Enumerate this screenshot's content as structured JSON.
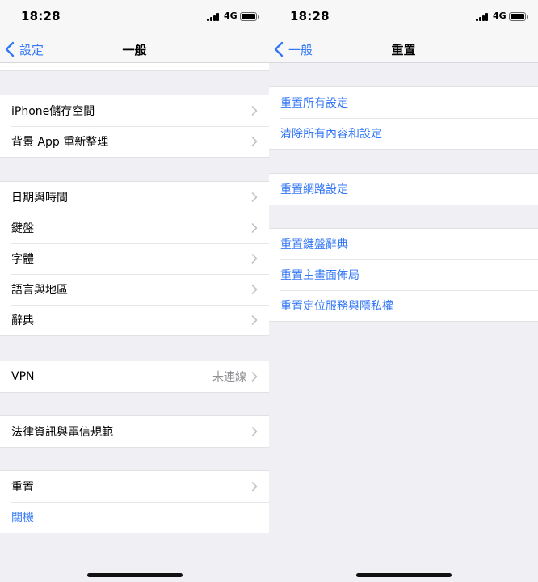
{
  "status": {
    "time": "18:28",
    "network": "4G"
  },
  "left": {
    "back_label": "設定",
    "title": "一般",
    "groups": [
      {
        "rows": [
          {
            "label": "iPhone儲存空間"
          },
          {
            "label": "背景 App 重新整理"
          }
        ]
      },
      {
        "rows": [
          {
            "label": "日期與時間"
          },
          {
            "label": "鍵盤"
          },
          {
            "label": "字體"
          },
          {
            "label": "語言與地區"
          },
          {
            "label": "辭典"
          }
        ]
      },
      {
        "rows": [
          {
            "label": "VPN",
            "value": "未連線"
          }
        ]
      },
      {
        "rows": [
          {
            "label": "法律資訊與電信規範"
          }
        ]
      },
      {
        "rows": [
          {
            "label": "重置"
          },
          {
            "label": "關機"
          }
        ]
      }
    ]
  },
  "right": {
    "back_label": "一般",
    "title": "重置",
    "groups": [
      {
        "rows": [
          {
            "label": "重置所有設定"
          },
          {
            "label": "清除所有內容和設定"
          }
        ]
      },
      {
        "rows": [
          {
            "label": "重置網路設定"
          }
        ]
      },
      {
        "rows": [
          {
            "label": "重置鍵盤辭典"
          },
          {
            "label": "重置主畫面佈局"
          },
          {
            "label": "重置定位服務與隱私權"
          }
        ]
      }
    ]
  },
  "colors": {
    "accent": "#3478f6",
    "background": "#efeff4",
    "secondary_text": "#8e8e93"
  },
  "icons": {
    "back": "chevron-left-icon",
    "disclosure": "chevron-right-icon",
    "signal": "signal-icon",
    "battery": "battery-icon"
  }
}
